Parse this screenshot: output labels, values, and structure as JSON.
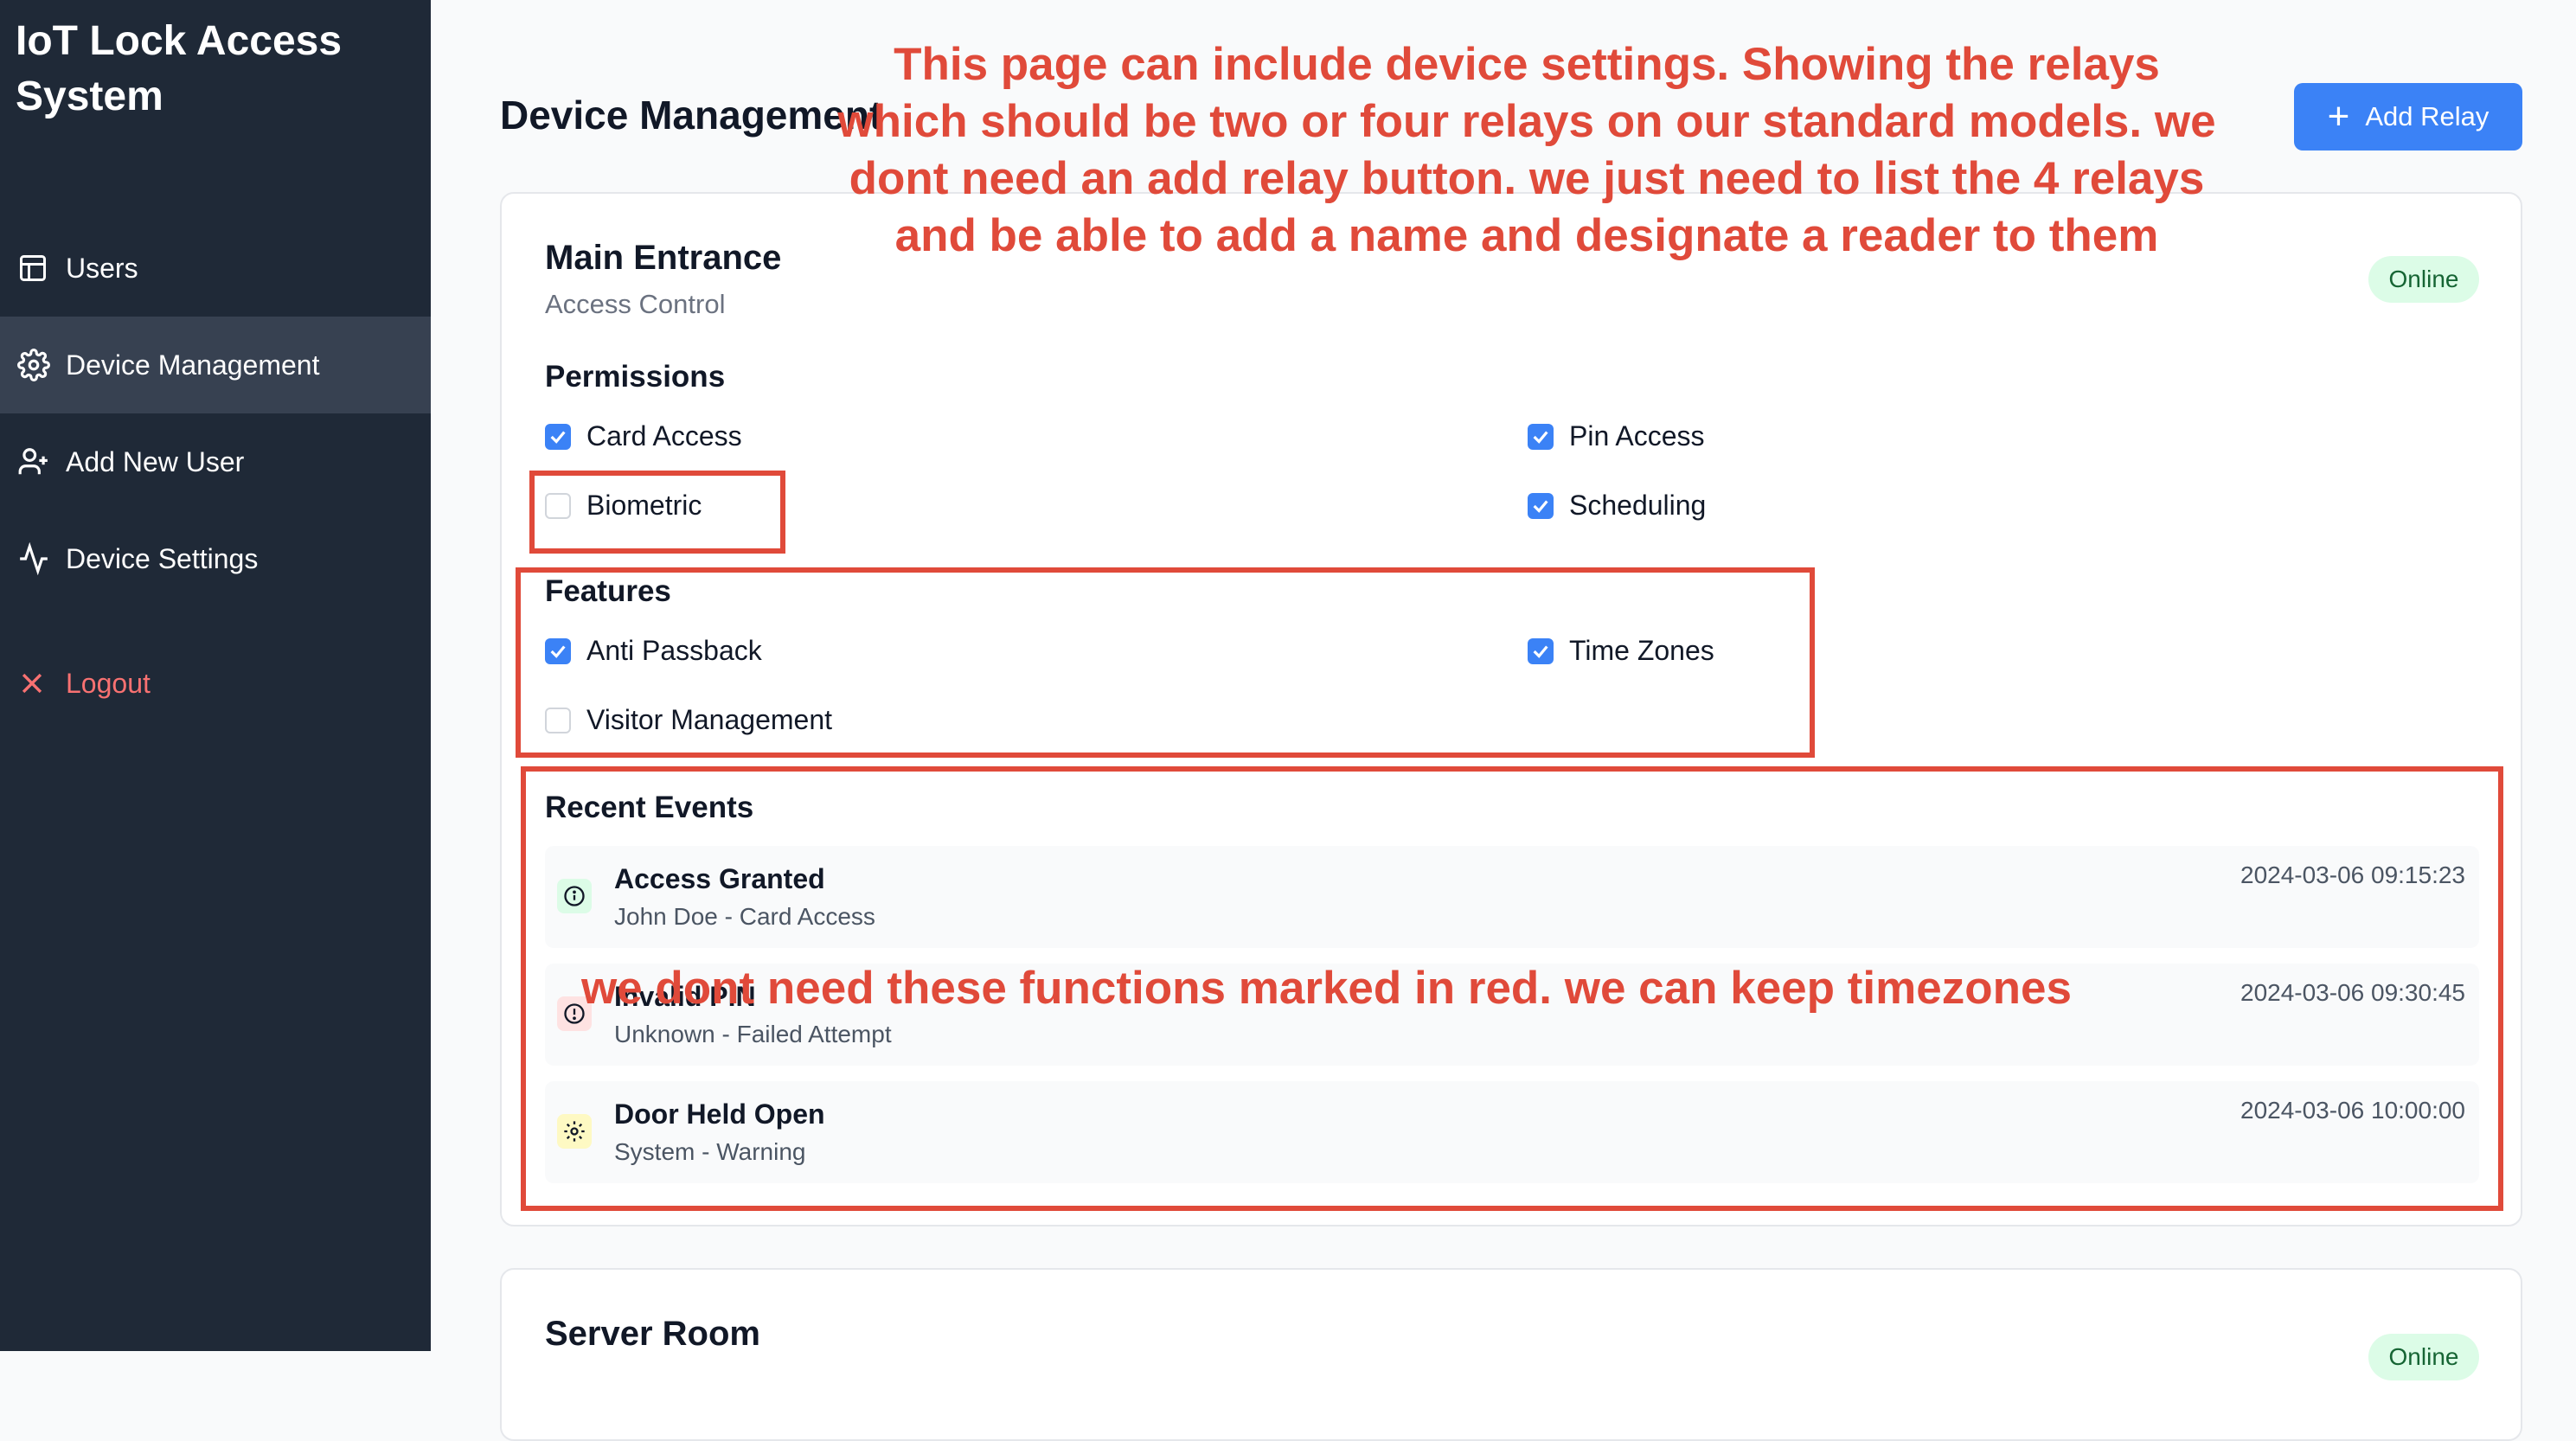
{
  "sidebar": {
    "app_title": "IoT Lock Access System",
    "items": [
      {
        "label": "Users",
        "icon": "table-icon"
      },
      {
        "label": "Device Management",
        "icon": "gear-icon",
        "active": true
      },
      {
        "label": "Add New User",
        "icon": "user-plus-icon"
      },
      {
        "label": "Device Settings",
        "icon": "activity-icon"
      }
    ],
    "logout_label": "Logout"
  },
  "header": {
    "title": "Device Management",
    "add_relay_label": "Add Relay"
  },
  "devices": [
    {
      "name": "Main Entrance",
      "type": "Access Control",
      "status": "Online",
      "permissions_title": "Permissions",
      "permissions": [
        {
          "label": "Card Access",
          "checked": true
        },
        {
          "label": "Pin Access",
          "checked": true
        },
        {
          "label": "Biometric",
          "checked": false
        },
        {
          "label": "Scheduling",
          "checked": true
        }
      ],
      "features_title": "Features",
      "features": [
        {
          "label": "Anti Passback",
          "checked": true
        },
        {
          "label": "Time Zones",
          "checked": true
        },
        {
          "label": "Visitor Management",
          "checked": false
        }
      ],
      "events_title": "Recent Events",
      "events": [
        {
          "title": "Access Granted",
          "sub": "John Doe - Card Access",
          "time": "2024-03-06 09:15:23",
          "kind": "info"
        },
        {
          "title": "Invalid PIN",
          "sub": "Unknown - Failed Attempt",
          "time": "2024-03-06 09:30:45",
          "kind": "error"
        },
        {
          "title": "Door Held Open",
          "sub": "System - Warning",
          "time": "2024-03-06 10:00:00",
          "kind": "warning"
        }
      ]
    },
    {
      "name": "Server Room",
      "status": "Online"
    }
  ],
  "annotations": {
    "top_note": "This page can include device settings. Showing the relays which should be two or four relays on our standard models. we dont need an add relay button. we just need to list the 4 relays and be able to add a name and designate a reader to them",
    "bottom_note": "we dont need these functions marked in red. we can keep timezones",
    "color": "#e04a3a"
  },
  "colors": {
    "sidebar_bg": "#1f2937",
    "active_item_bg": "#374151",
    "accent": "#3b82f6",
    "online_bg": "#dcfce7",
    "online_text": "#166534",
    "logout": "#f87171"
  }
}
